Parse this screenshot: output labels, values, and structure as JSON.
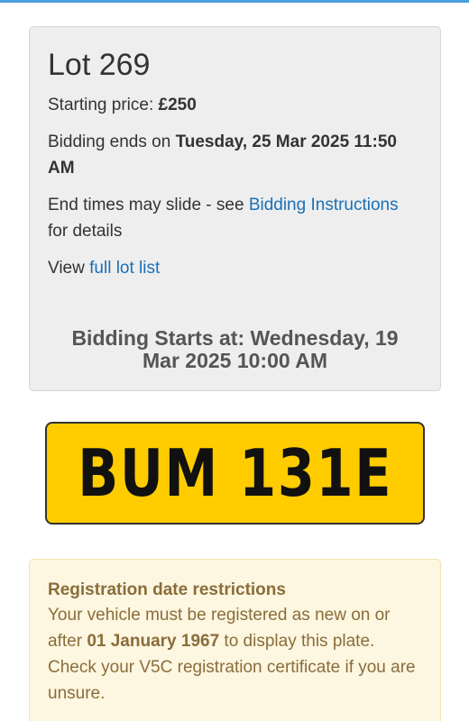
{
  "lot": {
    "title": "Lot 269",
    "starting_price_label": "Starting price: ",
    "starting_price_value": "£250",
    "ends_label": "Bidding ends on ",
    "ends_value": "Tuesday, 25 Mar 2025 11:50 AM",
    "slide_prefix": "End times may slide - see ",
    "slide_link": "Bidding Instructions",
    "slide_suffix": " for details",
    "view_prefix": "View ",
    "view_link": "full lot list",
    "bidding_starts": "Bidding Starts at: Wednesday, 19 Mar 2025 10:00 AM"
  },
  "plate": {
    "registration": "BUM 131E",
    "background_color": "#ffcc00"
  },
  "restriction": {
    "heading": "Registration date restrictions",
    "text_before": "Your vehicle must be registered as new on or after ",
    "date": "01 January 1967",
    "text_after": " to display this plate. Check your V5C registration certificate if you are unsure."
  },
  "colors": {
    "link": "#1a6fb8",
    "warning_text": "#8a6d3b",
    "warning_bg": "#fdf6e0"
  }
}
